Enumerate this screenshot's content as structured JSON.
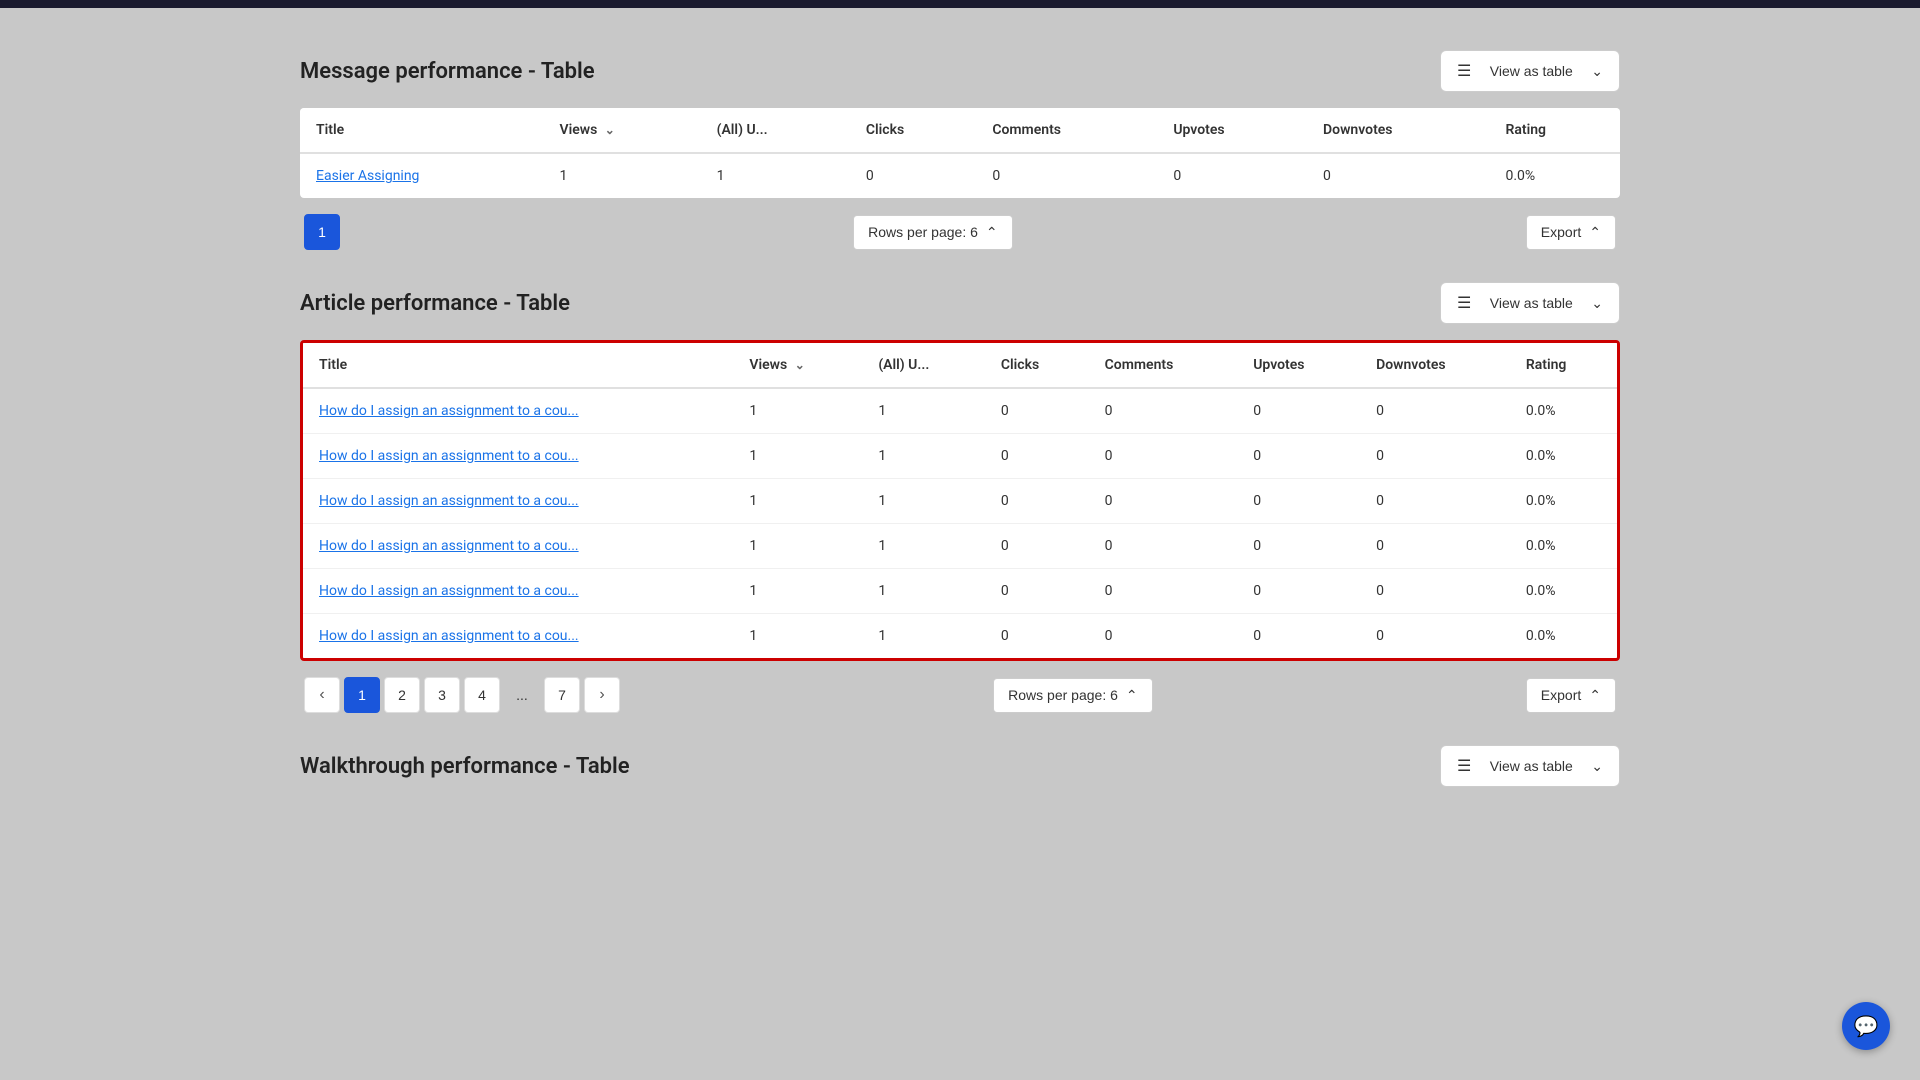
{
  "topbar": {},
  "sections": {
    "message_performance": {
      "title": "Message performance - Table",
      "view_as_table_label": "View as table",
      "columns": [
        "Title",
        "Views",
        "(All) U...",
        "Clicks",
        "Comments",
        "Upvotes",
        "Downvotes",
        "Rating"
      ],
      "rows": [
        {
          "title": "Easier Assigning",
          "views": "1",
          "all_u": "1",
          "clicks": "0",
          "comments": "0",
          "upvotes": "0",
          "downvotes": "0",
          "rating": "0.0%"
        }
      ],
      "pagination": {
        "current_page": 1,
        "rows_per_page_label": "Rows per page: 6",
        "export_label": "Export"
      }
    },
    "article_performance": {
      "title": "Article performance - Table",
      "view_as_table_label": "View as table",
      "columns": [
        "Title",
        "Views",
        "(All) U...",
        "Clicks",
        "Comments",
        "Upvotes",
        "Downvotes",
        "Rating"
      ],
      "rows": [
        {
          "title": "How do I assign an assignment to a cou...",
          "views": "1",
          "all_u": "1",
          "clicks": "0",
          "comments": "0",
          "upvotes": "0",
          "downvotes": "0",
          "rating": "0.0%"
        },
        {
          "title": "How do I assign an assignment to a cou...",
          "views": "1",
          "all_u": "1",
          "clicks": "0",
          "comments": "0",
          "upvotes": "0",
          "downvotes": "0",
          "rating": "0.0%"
        },
        {
          "title": "How do I assign an assignment to a cou...",
          "views": "1",
          "all_u": "1",
          "clicks": "0",
          "comments": "0",
          "upvotes": "0",
          "downvotes": "0",
          "rating": "0.0%"
        },
        {
          "title": "How do I assign an assignment to a cou...",
          "views": "1",
          "all_u": "1",
          "clicks": "0",
          "comments": "0",
          "upvotes": "0",
          "downvotes": "0",
          "rating": "0.0%"
        },
        {
          "title": "How do I assign an assignment to a cou...",
          "views": "1",
          "all_u": "1",
          "clicks": "0",
          "comments": "0",
          "upvotes": "0",
          "downvotes": "0",
          "rating": "0.0%"
        },
        {
          "title": "How do I assign an assignment to a cou...",
          "views": "1",
          "all_u": "1",
          "clicks": "0",
          "comments": "0",
          "upvotes": "0",
          "downvotes": "0",
          "rating": "0.0%"
        }
      ],
      "pagination": {
        "current_page": 1,
        "pages": [
          "1",
          "2",
          "3",
          "4",
          "...",
          "7"
        ],
        "rows_per_page_label": "Rows per page: 6",
        "export_label": "Export"
      }
    },
    "walkthrough_performance": {
      "title": "Walkthrough performance - Table",
      "view_as_table_label": "View as table"
    }
  },
  "chat_icon": "💬"
}
